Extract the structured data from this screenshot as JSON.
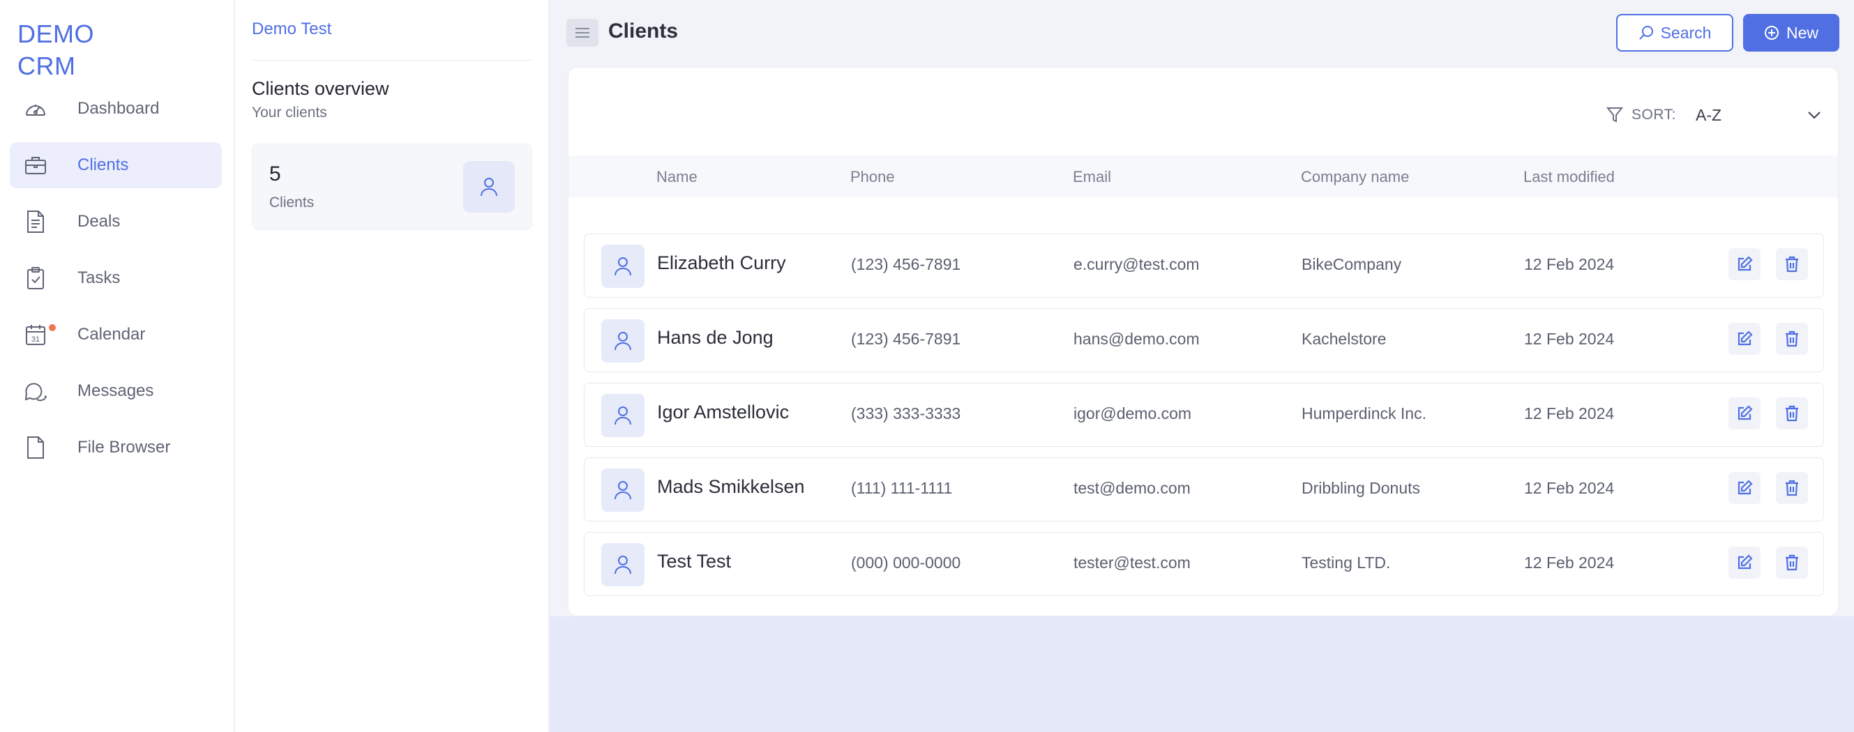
{
  "brand": {
    "line1": "DEMO",
    "line2": "CRM",
    "accent": "#4f6fe3"
  },
  "nav": {
    "items": [
      {
        "label": "Dashboard",
        "icon": "gauge-icon",
        "active": false
      },
      {
        "label": "Clients",
        "icon": "briefcase-icon",
        "active": true
      },
      {
        "label": "Deals",
        "icon": "document-icon",
        "active": false
      },
      {
        "label": "Tasks",
        "icon": "clipboard-check-icon",
        "active": false
      },
      {
        "label": "Calendar",
        "icon": "calendar-icon",
        "active": false,
        "calendar_day": "31",
        "notification": true
      },
      {
        "label": "Messages",
        "icon": "chat-bubbles-icon",
        "active": false
      },
      {
        "label": "File Browser",
        "icon": "file-icon",
        "active": false
      }
    ]
  },
  "panel": {
    "user": "Demo Test",
    "title": "Clients overview",
    "subtitle": "Your clients",
    "stat": {
      "value": "5",
      "label": "Clients",
      "icon": "user-icon"
    }
  },
  "header": {
    "title": "Clients",
    "search_label": "Search",
    "new_label": "New"
  },
  "sort": {
    "label": "SORT:",
    "value": "A-Z"
  },
  "table": {
    "columns": [
      "Name",
      "Phone",
      "Email",
      "Company name",
      "Last modified"
    ],
    "rows": [
      {
        "name": "Elizabeth Curry",
        "phone": "(123) 456-7891",
        "email": "e.curry@test.com",
        "company": "BikeCompany",
        "modified": "12 Feb 2024"
      },
      {
        "name": "Hans de Jong",
        "phone": "(123) 456-7891",
        "email": "hans@demo.com",
        "company": "Kachelstore",
        "modified": "12 Feb 2024"
      },
      {
        "name": "Igor Amstellovic",
        "phone": "(333) 333-3333",
        "email": "igor@demo.com",
        "company": "Humperdinck Inc.",
        "modified": "12 Feb 2024"
      },
      {
        "name": "Mads Smikkelsen",
        "phone": "(111) 111-1111",
        "email": "test@demo.com",
        "company": "Dribbling Donuts",
        "modified": "12 Feb 2024"
      },
      {
        "name": "Test Test",
        "phone": "(000) 000-0000",
        "email": "tester@test.com",
        "company": "Testing LTD.",
        "modified": "12 Feb 2024"
      }
    ]
  }
}
